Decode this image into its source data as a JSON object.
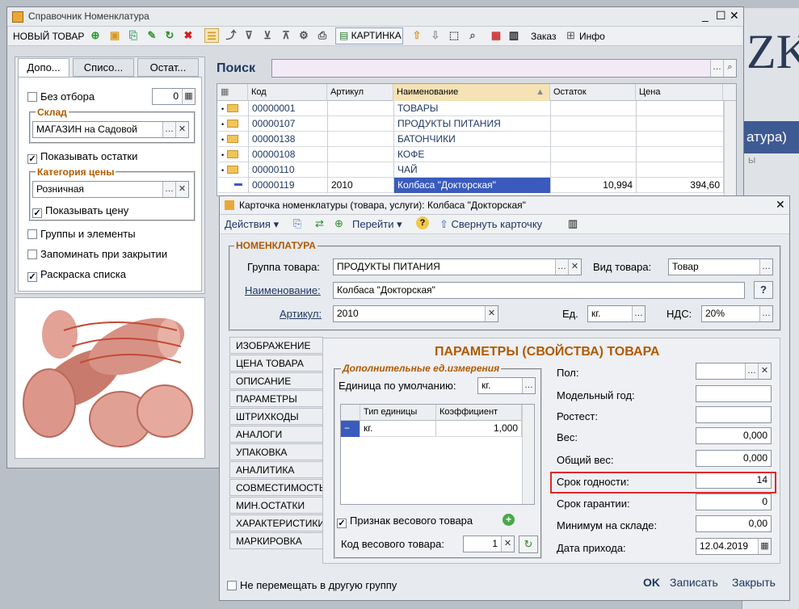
{
  "app": {
    "title": "Справочник Номенклатура",
    "bg_text": "ZK",
    "bg_text2": "атура)",
    "bg_text3": "ы"
  },
  "toolbar": {
    "new_item": "НОВЫЙ ТОВАР",
    "card": "КАРТИНКА",
    "order": "Заказ",
    "info": "Инфо"
  },
  "left": {
    "tabs": [
      "Допо...",
      "Списо...",
      "Остат..."
    ],
    "no_filter": "Без отбора",
    "no_filter_value": "0",
    "warehouse_label": "Склад",
    "warehouse_value": "МАГАЗИН на Садовой",
    "show_stock": "Показывать остатки",
    "price_cat_label": "Категория цены",
    "price_cat_value": "Розничная",
    "show_price": "Показывать цену",
    "groups_elements": "Группы и элементы",
    "remember_on_close": "Запоминать при закрытии",
    "color_list": "Раскраска списка"
  },
  "search": {
    "label": "Поиск",
    "value": ""
  },
  "table": {
    "columns": [
      "Код",
      "Артикул",
      "Наименование",
      "Остаток",
      "Цена"
    ],
    "rows": [
      {
        "code": "00000001",
        "article": "",
        "name": "ТОВАРЫ",
        "stock": "",
        "price": ""
      },
      {
        "code": "00000107",
        "article": "",
        "name": "ПРОДУКТЫ ПИТАНИЯ",
        "stock": "",
        "price": ""
      },
      {
        "code": "00000138",
        "article": "",
        "name": "БАТОНЧИКИ",
        "stock": "",
        "price": ""
      },
      {
        "code": "00000108",
        "article": "",
        "name": "КОФЕ",
        "stock": "",
        "price": ""
      },
      {
        "code": "00000110",
        "article": "",
        "name": "ЧАЙ",
        "stock": "",
        "price": ""
      },
      {
        "code": "00000119",
        "article": "2010",
        "name": "Колбаса \"Докторская\"",
        "stock": "10,994",
        "price": "394,60"
      }
    ]
  },
  "card": {
    "title": "Карточка номенклатуры (товара, услуги): Колбаса \"Докторская\"",
    "actions": "Действия",
    "goto": "Перейти",
    "collapse": "Свернуть карточку",
    "section": "НОМЕНКЛАТУРА",
    "group_label": "Группа товара:",
    "group_value": "ПРОДУКТЫ ПИТАНИЯ",
    "kind_label": "Вид товара:",
    "kind_value": "Товар",
    "name_label": "Наименование:",
    "name_value": "Колбаса \"Докторская\"",
    "help": "?",
    "article_label": "Артикул:",
    "article_value": "2010",
    "unit_label": "Ед.",
    "unit_value": "кг.",
    "vat_label": "НДС:",
    "vat_value": "20%",
    "tabs": [
      "ИЗОБРАЖЕНИЕ",
      "ЦЕНА ТОВАРА",
      "ОПИСАНИЕ",
      "ПАРАМЕТРЫ",
      "ШТРИХКОДЫ",
      "АНАЛОГИ",
      "УПАКОВКА",
      "АНАЛИТИКА",
      "СОВМЕСТИМОСТЬ",
      "МИН.ОСТАТКИ",
      "ХАРАКТЕРИСТИКИ",
      "МАРКИРОВКА"
    ],
    "params_title": "ПАРАМЕТРЫ (СВОЙСТВА) ТОВАРА",
    "units_group": "Дополнительные ед.измерения",
    "default_unit_label": "Единица по умолчанию:",
    "default_unit_value": "кг.",
    "unit_table": {
      "columns": [
        "Тип единицы",
        "Коэффициент"
      ],
      "rows": [
        {
          "type": "кг.",
          "coef": "1,000"
        }
      ]
    },
    "weight_flag": "Признак весового товара",
    "weight_code_label": "Код весового товара:",
    "weight_code_value": "1",
    "props": [
      {
        "label": "Пол:",
        "value": ""
      },
      {
        "label": "Модельный год:",
        "value": ""
      },
      {
        "label": "Ростест:",
        "value": ""
      },
      {
        "label": "Вес:",
        "value": "0,000"
      },
      {
        "label": "Общий вес:",
        "value": "0,000"
      },
      {
        "label": "Срок годности:",
        "value": "14"
      },
      {
        "label": "Срок гарантии:",
        "value": "0"
      },
      {
        "label": "Минимум на складе:",
        "value": "0,00"
      },
      {
        "label": "Дата прихода:",
        "value": "12.04.2019"
      }
    ],
    "no_move": "Не перемещать в другую группу",
    "ok": "OK",
    "record": "Записать",
    "close": "Закрыть"
  },
  "colors": {
    "accent_orange": "#b05a00",
    "highlight_red": "#e0282c",
    "selected_row": "#3a5bbd"
  }
}
